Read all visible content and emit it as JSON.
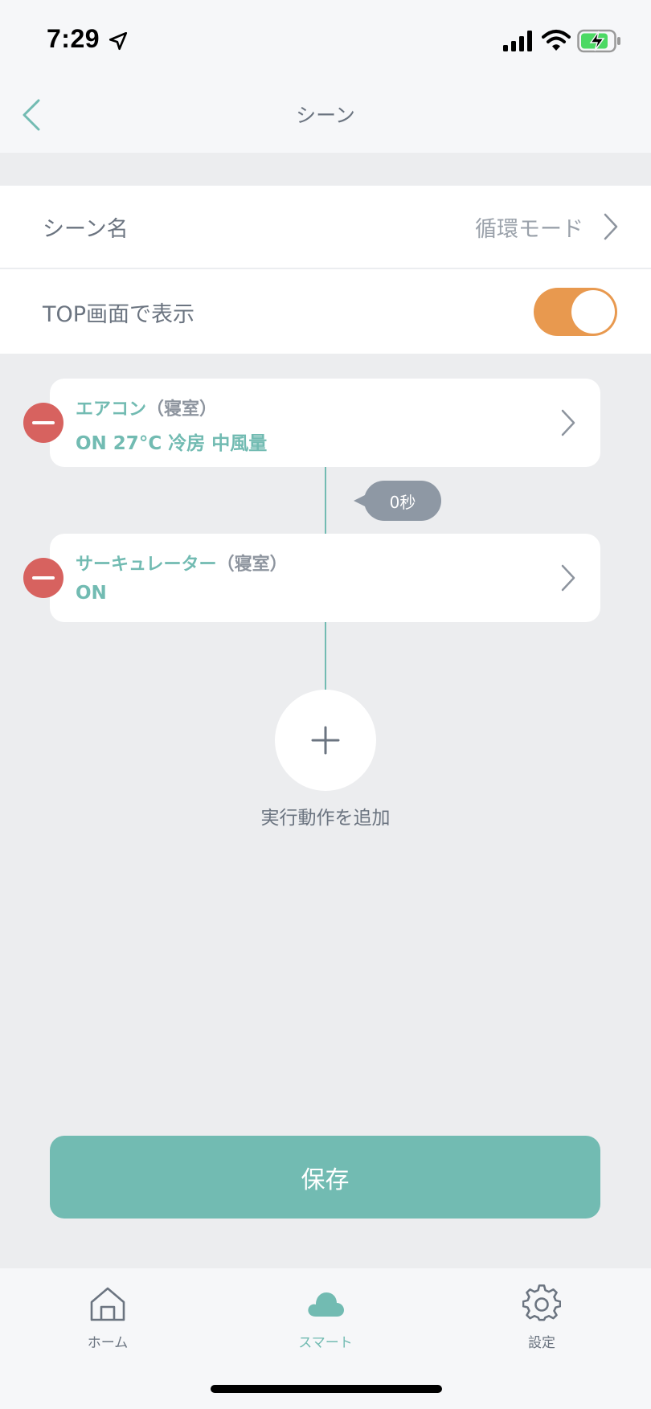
{
  "status_bar": {
    "time": "7:29"
  },
  "nav": {
    "title": "シーン"
  },
  "settings": {
    "scene_name_label": "シーン名",
    "scene_name_value": "循環モード",
    "show_top_label": "TOP画面で表示",
    "show_top_enabled": true
  },
  "actions": [
    {
      "device": "エアコン",
      "room": "（寝室）",
      "detail": "ON  27°C 冷房 中風量"
    },
    {
      "device": "サーキュレーター",
      "room": "（寝室）",
      "detail": "ON"
    }
  ],
  "delay": {
    "label": "0秒"
  },
  "add_action": {
    "label": "実行動作を追加"
  },
  "save_label": "保存",
  "tabs": [
    {
      "label": "ホーム",
      "active": false
    },
    {
      "label": "スマート",
      "active": true
    },
    {
      "label": "設定",
      "active": false
    }
  ],
  "colors": {
    "accent": "#72bbb2",
    "toggle_on": "#e8994f",
    "remove": "#d7625f",
    "badge": "#8e98a4"
  }
}
